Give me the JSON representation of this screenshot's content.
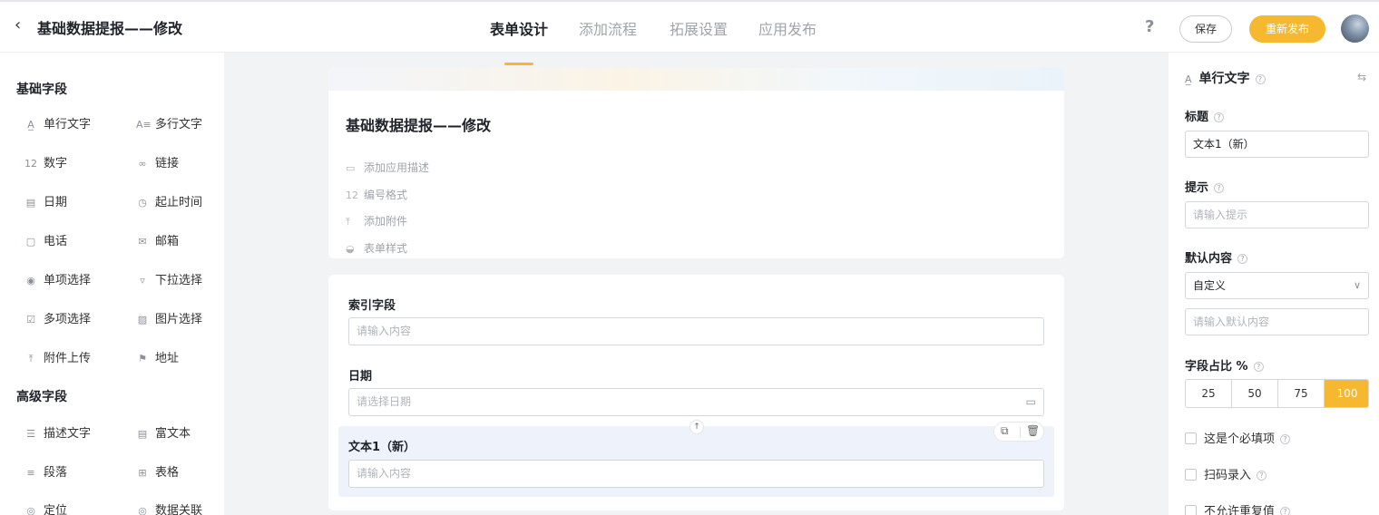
{
  "header": {
    "back_icon": "chevron-left-icon",
    "title": "基础数据提报——修改",
    "tabs": [
      {
        "label": "表单设计",
        "active": true
      },
      {
        "label": "添加流程",
        "active": false
      },
      {
        "label": "拓展设置",
        "active": false
      },
      {
        "label": "应用发布",
        "active": false
      }
    ],
    "help": "?",
    "save_label": "保存",
    "publish_label": "重新发布",
    "accent_color": "#f5b82e"
  },
  "left_panel": {
    "basic_title": "基础字段",
    "basic_fields": [
      {
        "label": "单行文字",
        "icon": "single-line-text-icon"
      },
      {
        "label": "多行文字",
        "icon": "multi-line-text-icon"
      },
      {
        "label": "数字",
        "icon": "number-icon"
      },
      {
        "label": "链接",
        "icon": "link-icon"
      },
      {
        "label": "日期",
        "icon": "date-icon"
      },
      {
        "label": "起止时间",
        "icon": "time-range-icon"
      },
      {
        "label": "电话",
        "icon": "phone-icon"
      },
      {
        "label": "邮箱",
        "icon": "mail-icon"
      },
      {
        "label": "单项选择",
        "icon": "radio-icon"
      },
      {
        "label": "下拉选择",
        "icon": "dropdown-icon"
      },
      {
        "label": "多项选择",
        "icon": "checkbox-icon"
      },
      {
        "label": "图片选择",
        "icon": "image-icon"
      },
      {
        "label": "附件上传",
        "icon": "upload-icon"
      },
      {
        "label": "地址",
        "icon": "address-icon"
      }
    ],
    "advanced_title": "高级字段",
    "advanced_fields": [
      {
        "label": "描述文字",
        "icon": "description-icon"
      },
      {
        "label": "富文本",
        "icon": "rich-text-icon"
      },
      {
        "label": "段落",
        "icon": "paragraph-icon"
      },
      {
        "label": "表格",
        "icon": "table-icon"
      },
      {
        "label": "定位",
        "icon": "location-icon"
      },
      {
        "label": "数据关联",
        "icon": "data-link-icon"
      }
    ]
  },
  "form_header": {
    "title": "基础数据提报——修改",
    "items": [
      {
        "label": "添加应用描述",
        "icon": "comment-icon"
      },
      {
        "label": "编号格式",
        "icon": "number-format-icon"
      },
      {
        "label": "添加附件",
        "icon": "attachment-icon"
      },
      {
        "label": "表单样式",
        "icon": "palette-icon"
      }
    ]
  },
  "form_fields": {
    "index_label": "索引字段",
    "index_placeholder": "请输入内容",
    "date_label": "日期",
    "date_placeholder": "请选择日期",
    "text_label": "文本1（新）",
    "text_placeholder": "请输入内容"
  },
  "right_panel": {
    "heading": "单行文字",
    "title_label": "标题",
    "title_value": "文本1（新）",
    "hint_label": "提示",
    "hint_placeholder": "请输入提示",
    "default_label": "默认内容",
    "default_mode": "自定义",
    "default_placeholder": "请输入默认内容",
    "ratio_label": "字段占比 %",
    "ratio_options": [
      "25",
      "50",
      "75",
      "100"
    ],
    "ratio_selected": "100",
    "checkboxes": [
      "这是个必填项",
      "扫码录入",
      "不允许重复值"
    ]
  }
}
